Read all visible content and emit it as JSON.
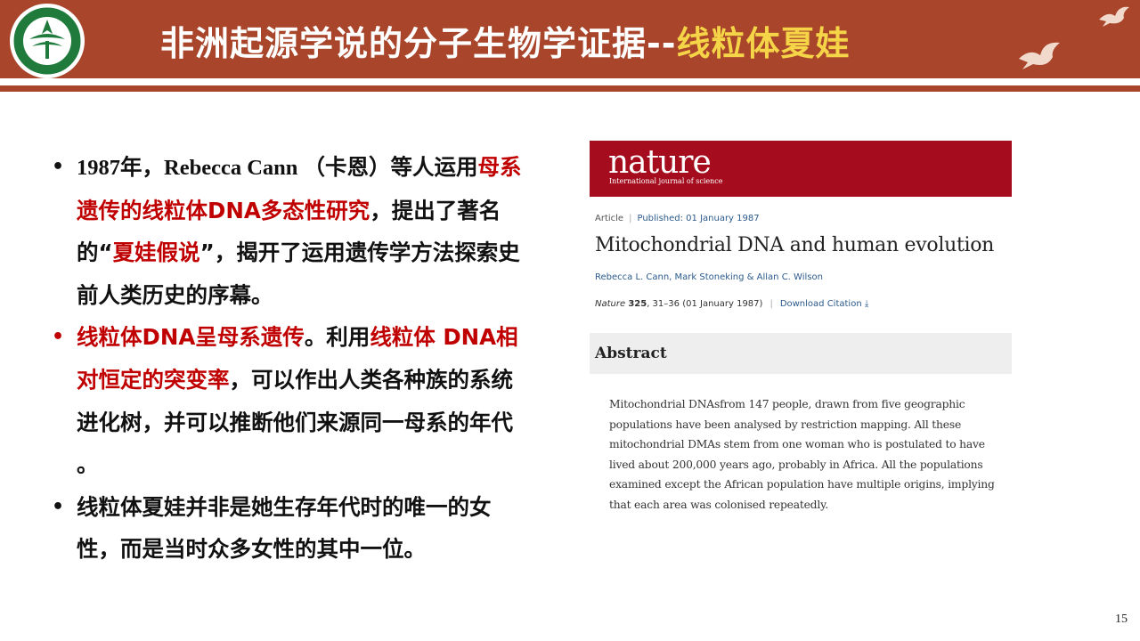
{
  "slide": {
    "page_number": "15",
    "colors": {
      "header_bg": "#a8452a",
      "title_accent": "#f5d547",
      "emphasis_red": "#c00000",
      "nature_red": "#a50d1e"
    }
  },
  "header": {
    "logo_icon": "university-logo-icon",
    "title_main": "非洲起源学说的分子生物学证据--",
    "title_accent": "线粒体夏娃"
  },
  "bullets": [
    {
      "segments": [
        {
          "text": "1987年，Rebecca Cann （卡恩）等人运用",
          "style": "normal"
        },
        {
          "text": "母系遗传的线粒体DNA多态性研究",
          "style": "red"
        },
        {
          "text": "，提出了著名的“",
          "style": "normal"
        },
        {
          "text": "夏娃假说",
          "style": "red"
        },
        {
          "text": "”，揭开了运用遗传学方法探索史前人类历史的序幕。",
          "style": "normal"
        }
      ]
    },
    {
      "segments": [
        {
          "text": "线粒体DNA呈母系遗传",
          "style": "red"
        },
        {
          "text": "。利用",
          "style": "normal"
        },
        {
          "text": "线粒体 DNA相对恒定的突变率",
          "style": "red"
        },
        {
          "text": "，可以作出人类各种族的系统进化树，并可以推断他们来源同一母系的年代 。",
          "style": "normal"
        }
      ]
    },
    {
      "segments": [
        {
          "text": "线粒体夏娃并非是她生存年代时的唯一的女性，而是当时众多女性的其中一位。",
          "style": "normal"
        }
      ]
    }
  ],
  "nature_card": {
    "journal": "nature",
    "journal_tagline": "International journal of science",
    "article_type": "Article",
    "published": "Published: 01 January 1987",
    "title": "Mitochondrial DNA and human evolution",
    "authors": "Rebecca L. Cann, Mark Stoneking & Allan C. Wilson",
    "citation_journal": "Nature",
    "citation_volume": "325",
    "citation_rest": ", 31–36 (01 January 1987)",
    "download": "Download Citation ⤓",
    "abstract_heading": "Abstract",
    "abstract_text": "Mitochondrial DNAsfrom 147 people, drawn from five geographic populations have been analysed by restriction mapping. All these mitochondrial DMAs stem from one woman who is postulated to have lived about 200,000 years ago, probably in Africa. All the populations examined except the African population have multiple origins, implying that each area was colonised repeatedly."
  }
}
